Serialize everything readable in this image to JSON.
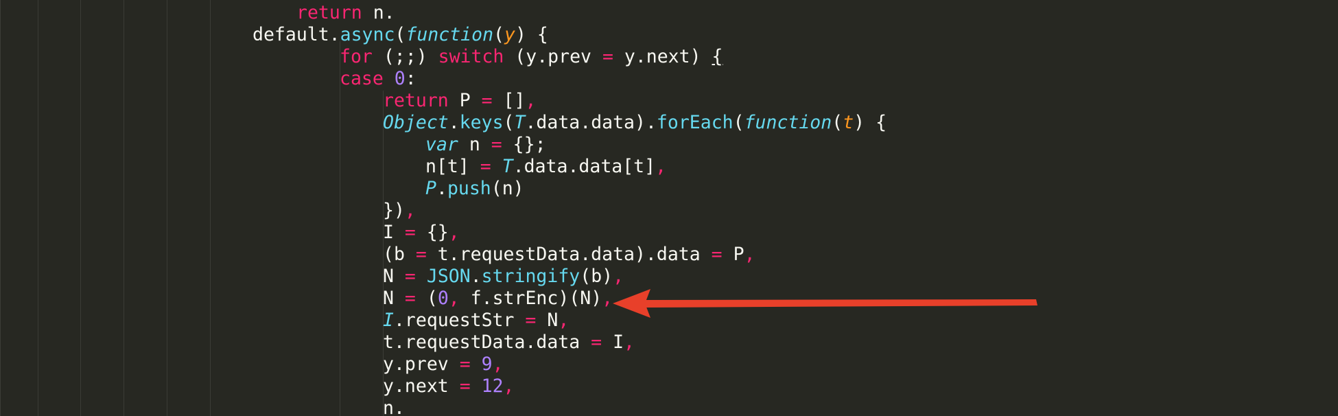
{
  "editor": {
    "theme_colors": {
      "background": "#272822",
      "keyword": "#f92672",
      "function": "#66d9ef",
      "param": "#fd971f",
      "number": "#ae81ff",
      "text": "#f8f8f2",
      "arrow": "#e8402a"
    },
    "lines": [
      [
        {
          "t": "return",
          "c": "kw"
        },
        {
          "t": " n.",
          "c": "pl"
        }
      ],
      [
        {
          "t": "default.",
          "c": "pl"
        },
        {
          "t": "async",
          "c": "fn"
        },
        {
          "t": "(",
          "c": "pl"
        },
        {
          "t": "function",
          "c": "ital"
        },
        {
          "t": "(",
          "c": "pl"
        },
        {
          "t": "y",
          "c": "par"
        },
        {
          "t": ") {",
          "c": "pl"
        }
      ],
      [
        {
          "t": "for",
          "c": "kw"
        },
        {
          "t": " (;;) ",
          "c": "pl"
        },
        {
          "t": "switch",
          "c": "kw"
        },
        {
          "t": " (y.prev ",
          "c": "pl"
        },
        {
          "t": "=",
          "c": "op"
        },
        {
          "t": " y.next) ",
          "c": "pl"
        },
        {
          "t": "{",
          "c": "ul"
        }
      ],
      [
        {
          "t": "case",
          "c": "kw"
        },
        {
          "t": " ",
          "c": "pl"
        },
        {
          "t": "0",
          "c": "num"
        },
        {
          "t": ":",
          "c": "pl"
        }
      ],
      [
        {
          "t": "return",
          "c": "kw"
        },
        {
          "t": " P ",
          "c": "pl"
        },
        {
          "t": "=",
          "c": "op"
        },
        {
          "t": " []",
          "c": "pl"
        },
        {
          "t": ",",
          "c": "op"
        }
      ],
      [
        {
          "t": "Object",
          "c": "ital"
        },
        {
          "t": ".",
          "c": "pl"
        },
        {
          "t": "keys",
          "c": "fn"
        },
        {
          "t": "(",
          "c": "pl"
        },
        {
          "t": "T",
          "c": "ital"
        },
        {
          "t": ".data.data).",
          "c": "pl"
        },
        {
          "t": "forEach",
          "c": "fn"
        },
        {
          "t": "(",
          "c": "pl"
        },
        {
          "t": "function",
          "c": "ital"
        },
        {
          "t": "(",
          "c": "pl"
        },
        {
          "t": "t",
          "c": "par"
        },
        {
          "t": ") {",
          "c": "pl"
        }
      ],
      [
        {
          "t": "var",
          "c": "ital"
        },
        {
          "t": " n ",
          "c": "pl"
        },
        {
          "t": "=",
          "c": "op"
        },
        {
          "t": " {};",
          "c": "pl"
        }
      ],
      [
        {
          "t": "n[t] ",
          "c": "pl"
        },
        {
          "t": "=",
          "c": "op"
        },
        {
          "t": " ",
          "c": "pl"
        },
        {
          "t": "T",
          "c": "ital"
        },
        {
          "t": ".data.data[t]",
          "c": "pl"
        },
        {
          "t": ",",
          "c": "op"
        }
      ],
      [
        {
          "t": "P",
          "c": "ital"
        },
        {
          "t": ".",
          "c": "pl"
        },
        {
          "t": "push",
          "c": "fn"
        },
        {
          "t": "(n)",
          "c": "pl"
        }
      ],
      [
        {
          "t": "})",
          "c": "pl"
        },
        {
          "t": ",",
          "c": "op"
        }
      ],
      [
        {
          "t": "I ",
          "c": "pl"
        },
        {
          "t": "=",
          "c": "op"
        },
        {
          "t": " {}",
          "c": "pl"
        },
        {
          "t": ",",
          "c": "op"
        }
      ],
      [
        {
          "t": "(b ",
          "c": "pl"
        },
        {
          "t": "=",
          "c": "op"
        },
        {
          "t": " t.requestData.data).data ",
          "c": "pl"
        },
        {
          "t": "=",
          "c": "op"
        },
        {
          "t": " P",
          "c": "pl"
        },
        {
          "t": ",",
          "c": "op"
        }
      ],
      [
        {
          "t": "N ",
          "c": "pl"
        },
        {
          "t": "=",
          "c": "op"
        },
        {
          "t": " ",
          "c": "pl"
        },
        {
          "t": "JSON",
          "c": "fn"
        },
        {
          "t": ".",
          "c": "pl"
        },
        {
          "t": "stringify",
          "c": "fn"
        },
        {
          "t": "(b)",
          "c": "pl"
        },
        {
          "t": ",",
          "c": "op"
        }
      ],
      [
        {
          "t": "N ",
          "c": "pl"
        },
        {
          "t": "=",
          "c": "op"
        },
        {
          "t": " (",
          "c": "pl"
        },
        {
          "t": "0",
          "c": "num"
        },
        {
          "t": ",",
          "c": "op"
        },
        {
          "t": " f.strEnc)(N)",
          "c": "pl"
        },
        {
          "t": ",",
          "c": "op"
        }
      ],
      [
        {
          "t": "I",
          "c": "ital"
        },
        {
          "t": ".requestStr ",
          "c": "pl"
        },
        {
          "t": "=",
          "c": "op"
        },
        {
          "t": " N",
          "c": "pl"
        },
        {
          "t": ",",
          "c": "op"
        }
      ],
      [
        {
          "t": "t.requestData.data ",
          "c": "pl"
        },
        {
          "t": "=",
          "c": "op"
        },
        {
          "t": " I",
          "c": "pl"
        },
        {
          "t": ",",
          "c": "op"
        }
      ],
      [
        {
          "t": "y.prev ",
          "c": "pl"
        },
        {
          "t": "=",
          "c": "op"
        },
        {
          "t": " ",
          "c": "pl"
        },
        {
          "t": "9",
          "c": "num"
        },
        {
          "t": ",",
          "c": "op"
        }
      ],
      [
        {
          "t": "y.next ",
          "c": "pl"
        },
        {
          "t": "=",
          "c": "op"
        },
        {
          "t": " ",
          "c": "pl"
        },
        {
          "t": "12",
          "c": "num"
        },
        {
          "t": ",",
          "c": "op"
        }
      ],
      [
        {
          "t": "n.",
          "c": "pl"
        }
      ]
    ]
  }
}
